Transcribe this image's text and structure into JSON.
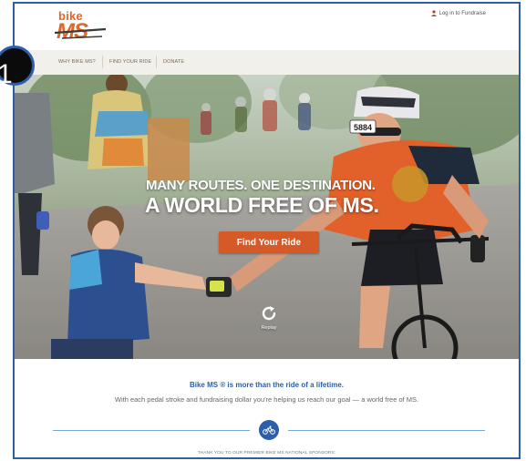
{
  "logo": {
    "bike": "bike",
    "ms": "MS"
  },
  "header": {
    "login_label": "Log in to Fundraise"
  },
  "nav": {
    "items": [
      "WHY BIKE MS?",
      "FIND YOUR RIDE",
      "DONATE"
    ]
  },
  "hero": {
    "tagline_line1": "MANY ROUTES. ONE DESTINATION.",
    "tagline_line2": "A WORLD FREE OF MS.",
    "cta_label": "Find Your Ride",
    "replay_label": "Replay",
    "bib_number": "5884"
  },
  "intro": {
    "title": "Bike MS ® is more than the ride of a lifetime.",
    "body": "With each pedal stroke and fundraising dollar you're helping us reach our goal — a world free of MS."
  },
  "sponsors": {
    "label": "THANK YOU TO OUR PREMIER BIKE MS NATIONAL SPONSORS:"
  },
  "step_badge": {
    "label": "1"
  },
  "colors": {
    "brand_orange": "#e0672a",
    "cta": "#d65a28",
    "brand_blue": "#2d5fa8",
    "nav_bg": "#f2f0ea"
  },
  "icons": [
    "user-icon",
    "replay-icon",
    "bicycle-icon"
  ]
}
